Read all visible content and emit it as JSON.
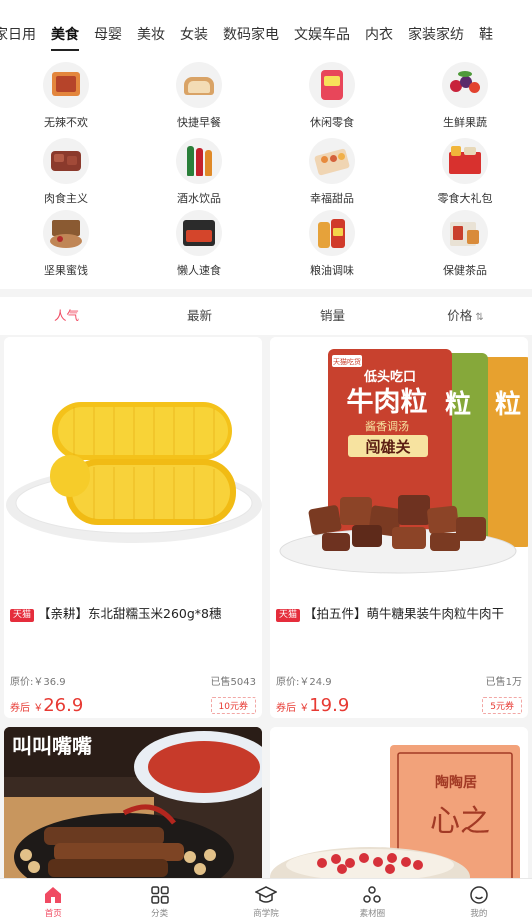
{
  "category_tabs": [
    "家日用",
    "美食",
    "母婴",
    "美妆",
    "女装",
    "数码家电",
    "文娱车品",
    "内衣",
    "家装家纺",
    "鞋"
  ],
  "active_category": "美食",
  "subcategories": [
    {
      "label": "无辣不欢",
      "icon": "spicy-meat-icon"
    },
    {
      "label": "快捷早餐",
      "icon": "bread-icon"
    },
    {
      "label": "休闲零食",
      "icon": "snack-bag-icon"
    },
    {
      "label": "生鲜果蔬",
      "icon": "fruit-icon"
    },
    {
      "label": "肉食主义",
      "icon": "beef-icon"
    },
    {
      "label": "酒水饮品",
      "icon": "drink-bottles-icon"
    },
    {
      "label": "幸福甜品",
      "icon": "dessert-box-icon"
    },
    {
      "label": "零食大礼包",
      "icon": "gift-box-icon"
    },
    {
      "label": "坚果蜜饯",
      "icon": "nuts-icon"
    },
    {
      "label": "懒人速食",
      "icon": "instant-noodle-icon"
    },
    {
      "label": "粮油调味",
      "icon": "oil-bottle-icon"
    },
    {
      "label": "保健茶品",
      "icon": "tea-box-icon"
    }
  ],
  "sort_options": [
    {
      "label": "人气",
      "active": true
    },
    {
      "label": "最新",
      "active": false
    },
    {
      "label": "销量",
      "active": false
    },
    {
      "label": "价格",
      "active": false
    }
  ],
  "sort_arrow": "⇅",
  "products": [
    {
      "badge": "天猫",
      "title": "【亲耕】东北甜糯玉米260g*8穗",
      "original_price": "原价:￥36.9",
      "sold": "已售5043",
      "after_label": "券后",
      "currency": "￥",
      "final_price": "26.9",
      "coupon": "10元券",
      "image": "corn-image"
    },
    {
      "badge": "天猫",
      "title": "【拍五件】萌牛糖果装牛肉粒牛肉干",
      "original_price": "原价:￥24.9",
      "sold": "已售1万",
      "after_label": "券后",
      "currency": "￥",
      "final_price": "19.9",
      "coupon": "5元券",
      "image": "beef-jerky-image",
      "package_text": {
        "top": "低头吃口",
        "main": "牛肉粒",
        "sub": "酱香调汤",
        "brand": "闯雄关",
        "side1": "粒",
        "side2": "粒"
      }
    },
    {
      "image": "braised-meat-image",
      "package_text": {
        "brand": "叫叫嘴嘴"
      }
    },
    {
      "image": "dessert-bowl-image",
      "package_text": {
        "brand": "陶陶居",
        "main": "心之"
      }
    }
  ],
  "bottom_nav": [
    {
      "label": "首页",
      "icon": "home-icon",
      "active": true
    },
    {
      "label": "分类",
      "icon": "grid-icon",
      "active": false
    },
    {
      "label": "商学院",
      "icon": "graduation-cap-icon",
      "active": false
    },
    {
      "label": "素材圈",
      "icon": "share-circles-icon",
      "active": false
    },
    {
      "label": "我的",
      "icon": "smiley-icon",
      "active": false
    }
  ],
  "colors": {
    "accent": "#f04a62",
    "price": "#e73a33",
    "tmall": "#e52d3c"
  }
}
